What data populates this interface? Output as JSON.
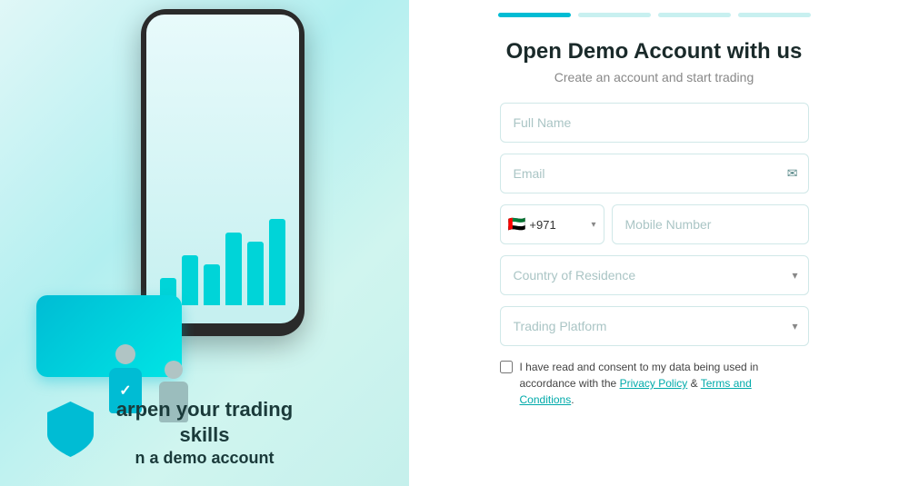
{
  "left": {
    "heading_line1": "arpen your trading",
    "heading_line2": "skills",
    "heading_line3": "n a demo account",
    "bars": [
      30,
      55,
      45,
      80,
      70,
      95
    ]
  },
  "progress": {
    "steps": [
      {
        "active": true
      },
      {
        "active": false
      },
      {
        "active": false
      },
      {
        "active": false
      }
    ]
  },
  "form": {
    "title": "Open Demo Account with us",
    "subtitle": "Create an account and start trading",
    "full_name_placeholder": "Full Name",
    "email_placeholder": "Email",
    "country_code_flag": "🇦🇪",
    "country_code_text": "+971",
    "mobile_placeholder": "Mobile Number",
    "country_placeholder": "Country of Residence",
    "platform_placeholder": "Trading Platform",
    "consent_text": "I have read and consent to my data being used in accordance with the ",
    "privacy_policy_label": "Privacy Policy",
    "consent_ampersand": " & ",
    "terms_label": "Terms and Conditions",
    "consent_end": "."
  }
}
